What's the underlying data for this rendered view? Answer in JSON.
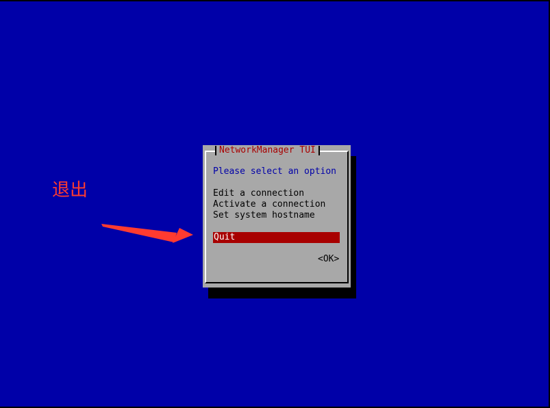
{
  "dialog": {
    "title": "NetworkManager TUI",
    "prompt": "Please select an option",
    "menu_items": [
      {
        "label": "Edit a connection",
        "selected": false
      },
      {
        "label": "Activate a connection",
        "selected": false
      },
      {
        "label": "Set system hostname",
        "selected": false
      },
      {
        "label": "Quit",
        "selected": true
      }
    ],
    "ok_label": "<OK>"
  },
  "annotation": {
    "label": "退出",
    "color": "#ff3b30"
  },
  "colors": {
    "background": "#0000a8",
    "dialog": "#a8a8a8",
    "title_text": "#a80000",
    "prompt_text": "#0000a8",
    "selection": "#a80000"
  }
}
